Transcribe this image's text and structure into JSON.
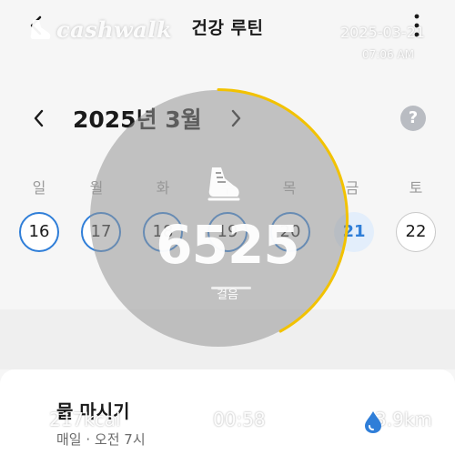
{
  "header": {
    "title": "건강 루틴"
  },
  "overlay": {
    "brand": "cashwalk",
    "date": "2025-03-21",
    "time": "07:06 AM",
    "steps": "6525",
    "steps_label": "걸음",
    "progress": 0.42,
    "accent_color": "#f2c200",
    "stats": {
      "calories": "217kcal",
      "duration": "00:58",
      "distance": "3.9km"
    }
  },
  "calendar": {
    "month_label": "2025년 3월",
    "weekdays": [
      "일",
      "월",
      "화",
      "수",
      "목",
      "금",
      "토"
    ],
    "days": [
      "16",
      "17",
      "18",
      "19",
      "20",
      "21",
      "22"
    ],
    "today": "21"
  },
  "card": {
    "title": "물 마시기",
    "subtitle": "매일 · 오전 7시"
  },
  "colors": {
    "primary": "#2f7ed8",
    "today_bg": "#e3eefb"
  }
}
